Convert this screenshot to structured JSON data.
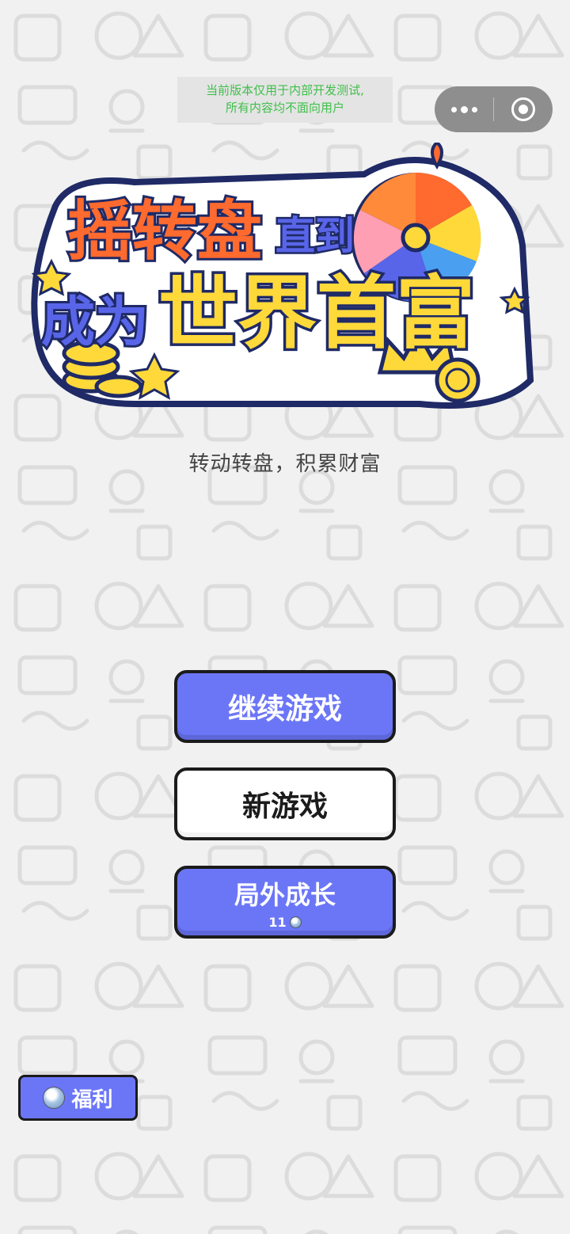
{
  "dev_notice": {
    "line1": "当前版本仅用于内部开发测试,",
    "line2": "所有内容均不面向用户"
  },
  "capsule": {
    "more_icon": "more-dots-icon",
    "close_icon": "target-circle-icon"
  },
  "logo": {
    "line1_part1": "摇转盘",
    "line1_part2": "直到",
    "line2_part1": "成为",
    "line2_part2": "世界首富"
  },
  "subtitle": "转动转盘，积累财富",
  "buttons": {
    "continue_label": "继续游戏",
    "new_game_label": "新游戏",
    "growth_label": "局外成长",
    "growth_cost": "11",
    "welfare_label": "福利"
  },
  "colors": {
    "primary_button": "#6b76f7",
    "background": "#f1f1f1",
    "logo_orange": "#ff6a2e",
    "logo_blue": "#5965e8",
    "logo_yellow": "#ffd93a"
  }
}
